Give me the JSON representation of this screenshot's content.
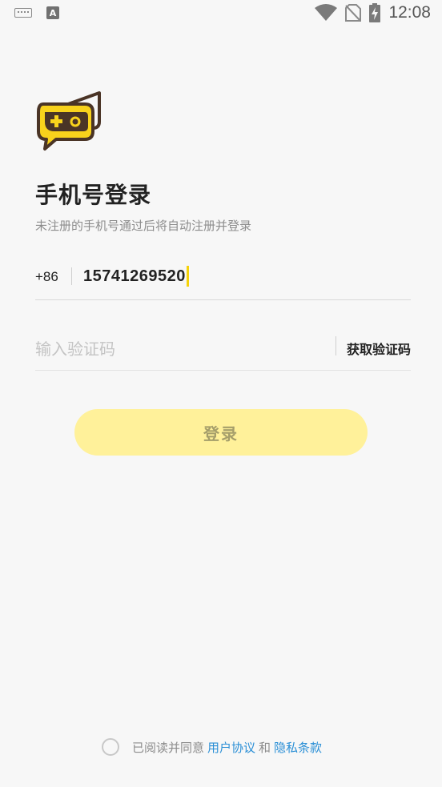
{
  "status_bar": {
    "time": "12:08",
    "icons": [
      "keyboard-icon",
      "a-icon",
      "wifi-icon",
      "no-sim-icon",
      "battery-charging-icon"
    ]
  },
  "header": {
    "title": "手机号登录",
    "subtitle": "未注册的手机号通过后将自动注册并登录"
  },
  "form": {
    "country_code": "+86",
    "phone_value": "15741269520",
    "code_placeholder": "输入验证码",
    "get_code_label": "获取验证码",
    "login_label": "登录"
  },
  "agreement": {
    "prefix": "已阅读并同意",
    "user_agreement": "用户协议",
    "and": "和",
    "privacy_policy": "隐私条款"
  },
  "colors": {
    "accent": "#f5d20a",
    "login_button_bg": "#fff19a",
    "link": "#2a8fd6",
    "logo_brown": "#4a3426",
    "logo_yellow": "#f8d21c"
  }
}
